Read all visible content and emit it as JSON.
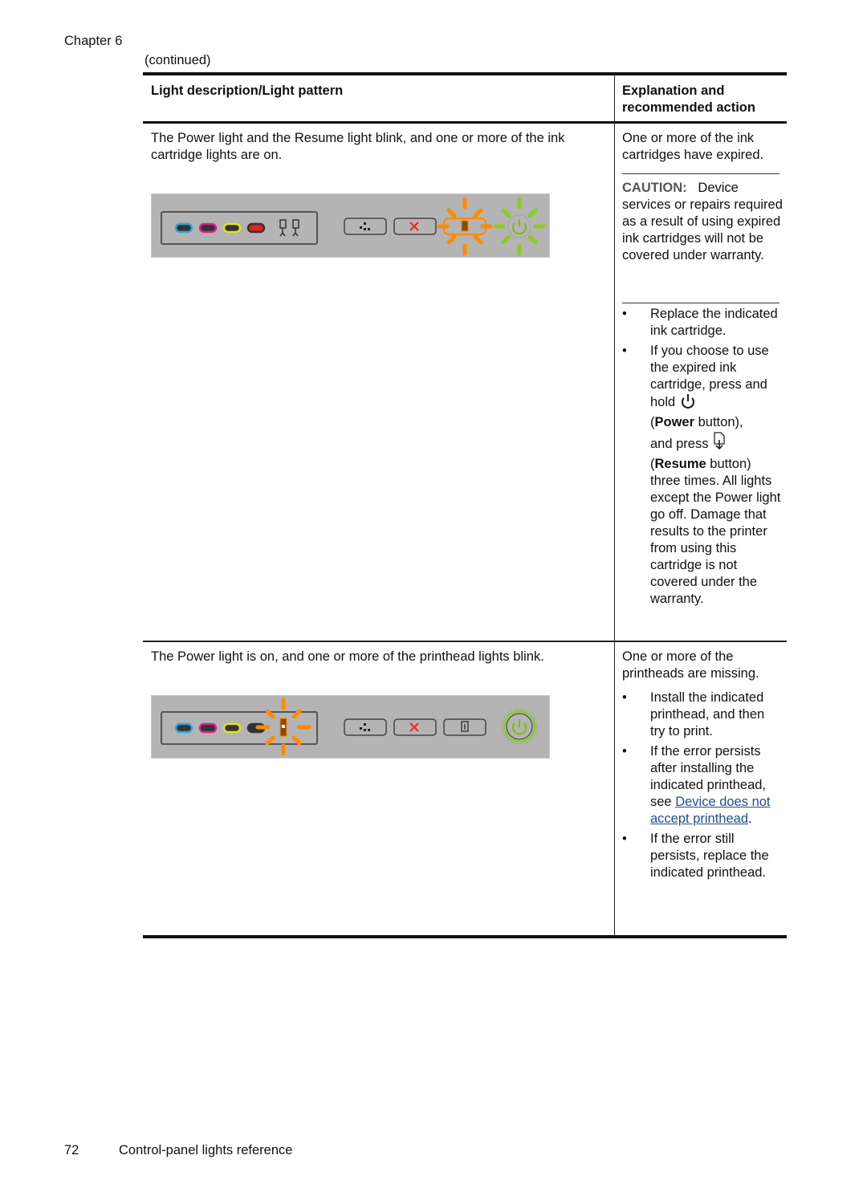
{
  "header": {
    "chapter": "Chapter 6",
    "continued": "(continued)"
  },
  "table": {
    "columns": [
      "Light description/Light pattern",
      "Explanation and recommended action"
    ],
    "rows": [
      {
        "description": "The Power light and the Resume light blink, and one or more of the ink cartridge lights are on.",
        "panel": {
          "ink_lights": [
            "cyan",
            "magenta",
            "yellow",
            "black"
          ],
          "ink_light_lit": "black",
          "printhead_icons": 2,
          "buttons": [
            "network-icon",
            "cancel-icon",
            "resume-icon",
            "power-icon"
          ],
          "resume_state": "blinking",
          "power_state": "blinking"
        },
        "explanation": "One or more of the ink cartridges have expired.",
        "caution_label": "CAUTION:",
        "caution_text": "Device services or repairs required as a result of using expired ink cartridges will not be covered under warranty.",
        "actions": [
          {
            "text": "Replace the indicated ink cartridge."
          },
          {
            "part1": "If you choose to use the expired ink cartridge, press and hold",
            "power_open": "(",
            "power_label": "Power",
            "power_close": " button),",
            "part2": "and press",
            "resume_open": "(",
            "resume_label": "Resume",
            "resume_close": " button)",
            "part3": "three times. All lights except the Power light go off. Damage that results to the printer from using this cartridge is not covered under the warranty."
          }
        ]
      },
      {
        "description": "The Power light is on, and one or more of the printhead lights blink.",
        "panel": {
          "ink_lights": [
            "cyan",
            "magenta",
            "yellow",
            "black"
          ],
          "printhead_state": "blinking",
          "buttons": [
            "network-icon",
            "cancel-icon",
            "resume-icon",
            "power-icon"
          ],
          "power_state": "on"
        },
        "explanation": "One or more of the printheads are missing.",
        "actions": [
          {
            "text": "Install the indicated printhead, and then try to print."
          },
          {
            "before": "If the error persists after installing the indicated printhead, see ",
            "link": "Device does not accept printhead",
            "after": "."
          },
          {
            "text": "If the error still persists, replace the indicated printhead."
          }
        ]
      }
    ]
  },
  "footer": {
    "page_number": "72",
    "section_title": "Control-panel lights reference"
  },
  "colors": {
    "cyan": "#2aa8dc",
    "magenta": "#e0208a",
    "yellow": "#e6e21a",
    "red": "#e8201e",
    "orange": "#ff8a00",
    "green": "#8dcc1e",
    "caution": "#555555",
    "link": "#1f4e8c",
    "panel_bg": "#b4b4b4"
  }
}
